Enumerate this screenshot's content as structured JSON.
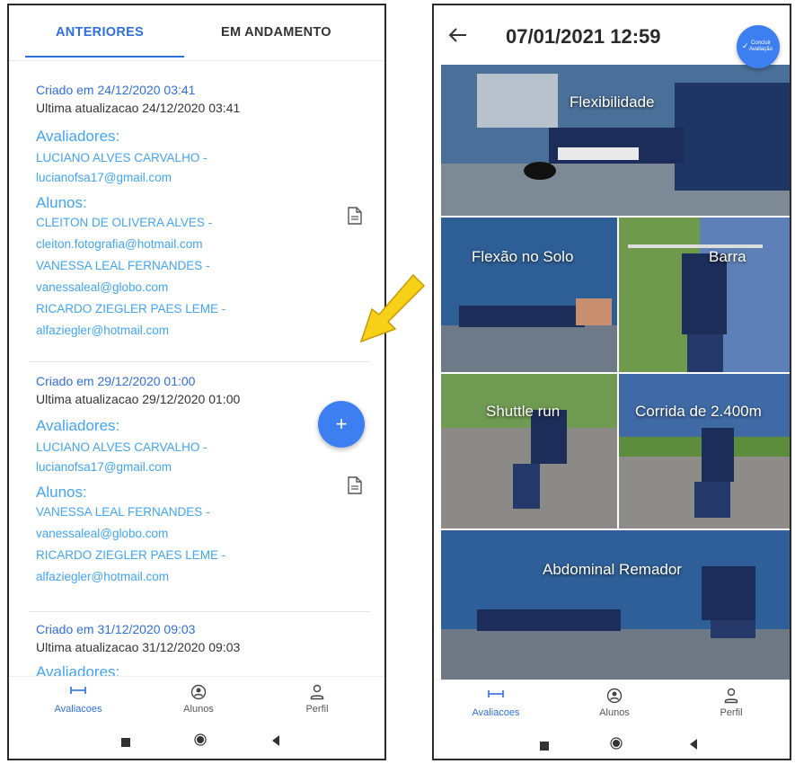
{
  "left_screen": {
    "tabs": {
      "active": "ANTERIORES",
      "other": "EM ANDAMENTO"
    },
    "evaluations": [
      {
        "created": "Criado em 24/12/2020 03:41",
        "updated": "Ultima atualizacao 24/12/2020 03:41",
        "evaluators_label": "Avaliadores:",
        "evaluators": [
          "LUCIANO ALVES CARVALHO -",
          "lucianofsa17@gmail.com"
        ],
        "students_label": "Alunos:",
        "students": [
          "CLEITON DE OLIVERA ALVES -",
          "cleiton.fotografia@hotmail.com",
          "VANESSA LEAL FERNANDES -",
          "vanessaleal@globo.com",
          "RICARDO ZIEGLER PAES LEME -",
          "alfaziegler@hotmail.com"
        ]
      },
      {
        "created": "Criado em 29/12/2020 01:00",
        "updated": "Ultima atualizacao 29/12/2020 01:00",
        "evaluators_label": "Avaliadores:",
        "evaluators": [
          "LUCIANO ALVES CARVALHO -",
          "lucianofsa17@gmail.com"
        ],
        "students_label": "Alunos:",
        "students": [
          "VANESSA LEAL FERNANDES -",
          "vanessaleal@globo.com",
          "RICARDO ZIEGLER PAES LEME -",
          "alfaziegler@hotmail.com"
        ]
      },
      {
        "created": "Criado em 31/12/2020 09:03",
        "updated": "Ultima atualizacao 31/12/2020 09:03",
        "evaluators_label": "Avaliadores:"
      }
    ],
    "fab_icon": "+"
  },
  "bottom_nav": {
    "items": [
      {
        "label": "Avaliacoes",
        "icon": "ruler-icon",
        "active": true
      },
      {
        "label": "Alunos",
        "icon": "account-circle-icon",
        "active": false
      },
      {
        "label": "Perfil",
        "icon": "person-outline-icon",
        "active": false
      }
    ]
  },
  "right_screen": {
    "title": "07/01/2021 12:59",
    "fab_label": "Concluir Avaliação",
    "tiles": [
      {
        "label": "Flexibilidade"
      },
      {
        "label": "Flexão no Solo"
      },
      {
        "label": "Barra"
      },
      {
        "label": "Shuttle run"
      },
      {
        "label": "Corrida de 2.400m"
      },
      {
        "label": "Abdominal Remador"
      }
    ]
  },
  "colors": {
    "accent": "#2f6fe0",
    "section_text": "#42a5f5",
    "fab": "#3d7ff0",
    "arrow": "#f7d117"
  }
}
